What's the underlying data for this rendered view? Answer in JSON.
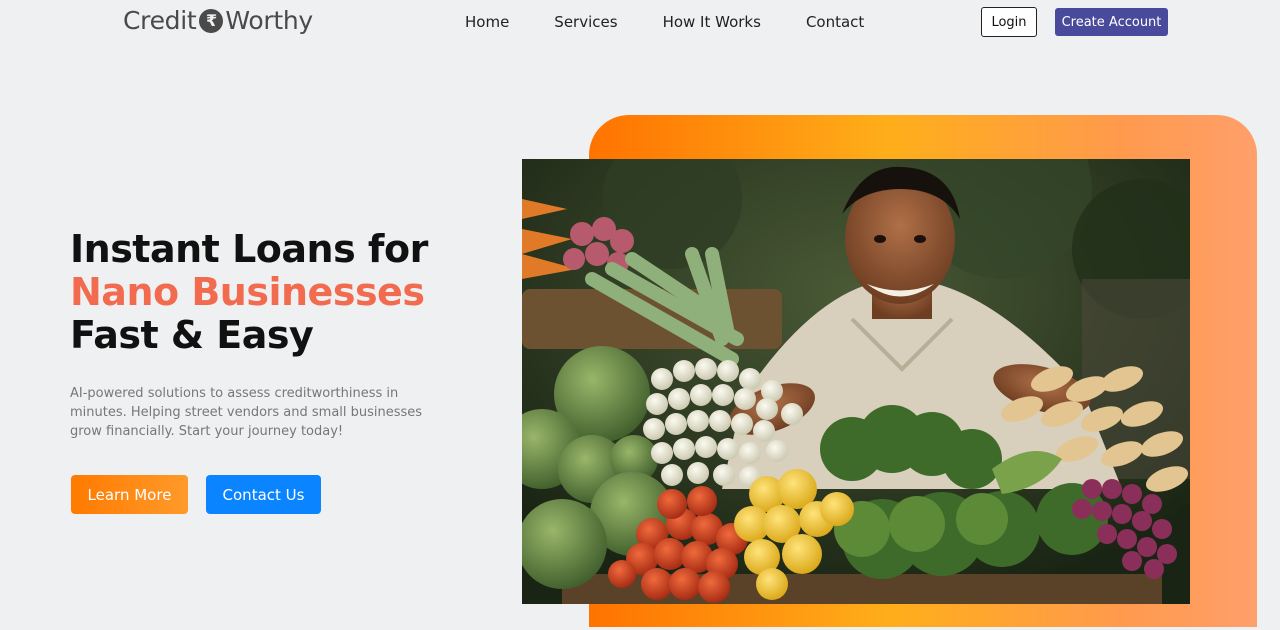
{
  "header": {
    "logo_left": "Credit",
    "logo_symbol": "₹",
    "logo_right": "Worthy",
    "nav": [
      "Home",
      "Services",
      "How It Works",
      "Contact"
    ],
    "login_label": "Login",
    "create_account_label": "Create Account"
  },
  "hero": {
    "headline_line1": "Instant Loans for",
    "headline_line2": "Nano Businesses",
    "headline_line3": "Fast & Easy",
    "subtext": "AI-powered solutions to assess creditworthiness in minutes. Helping street vendors and small businesses grow financially. Start your journey today!",
    "learn_more_label": "Learn More",
    "contact_us_label": "Contact Us"
  },
  "colors": {
    "accent": "#f26b4f",
    "create_account_bg": "#4a4a9c",
    "learn_more_bg": "#ff7a00",
    "contact_us_bg": "#0a84ff"
  }
}
